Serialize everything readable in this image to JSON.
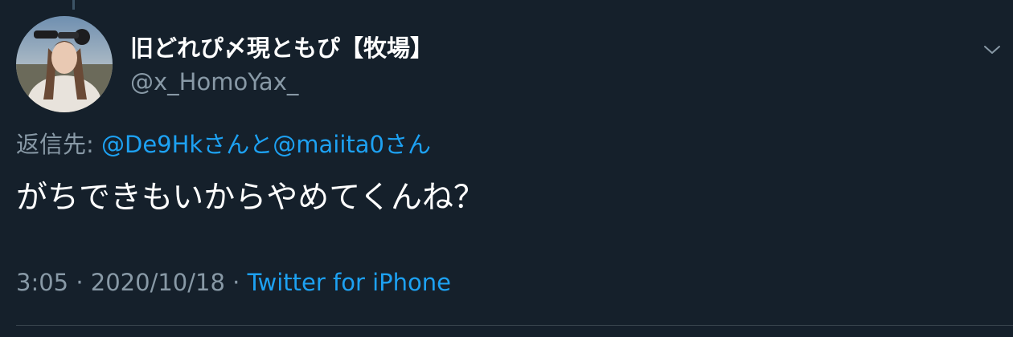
{
  "tweet": {
    "display_name": "旧どれぴ〆現ともぴ【牧場】",
    "handle": "@x_HomoYax_",
    "reply_prefix": "返信先: ",
    "reply_mention_1": "@De9Hk",
    "reply_joiner": "さんと",
    "reply_mention_2": "@maiita0",
    "reply_suffix": "さん",
    "text": "がちできもいからやめてくんね？",
    "time": "3:05",
    "separator_1": " · ",
    "date": "2020/10/18",
    "separator_2": " · ",
    "source": "Twitter for iPhone"
  },
  "icons": {
    "menu": "chevron-down-icon",
    "avatar": "avatar"
  },
  "colors": {
    "background": "#15202b",
    "primary_text": "#ffffff",
    "secondary_text": "#8899a6",
    "link": "#1da1f2",
    "divider": "#38444d"
  }
}
